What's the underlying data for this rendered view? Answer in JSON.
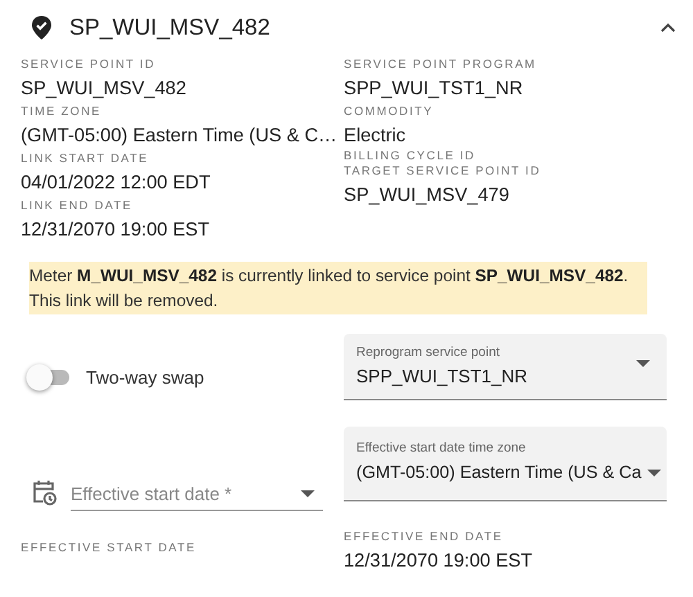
{
  "header": {
    "title": "SP_WUI_MSV_482",
    "expanded": true
  },
  "details": {
    "columns": [
      [
        {
          "label": "SERVICE POINT ID",
          "value": "SP_WUI_MSV_482"
        },
        {
          "label": "TIME ZONE",
          "value": "(GMT-05:00) Eastern Time (US & C…"
        },
        {
          "label": "LINK START DATE",
          "value": "04/01/2022 12:00 EDT"
        },
        {
          "label": "LINK END DATE",
          "value": "12/31/2070 19:00 EST"
        }
      ],
      [
        {
          "label": "SERVICE POINT PROGRAM",
          "value": "SPP_WUI_TST1_NR"
        },
        {
          "label": "COMMODITY",
          "value": "Electric"
        },
        {
          "label": "BILLING CYCLE ID"
        },
        {
          "label": "TARGET SERVICE POINT ID",
          "value": "SP_WUI_MSV_479"
        }
      ]
    ]
  },
  "banner": {
    "text": "Meter **M_WUI_MSV_482** is currently linked to service point **SP_WUI_MSV_482**. This link will be removed."
  },
  "form": {
    "rows": [
      [
        {
          "kind": "toggle",
          "label": "Two-way swap",
          "on": false
        },
        {
          "kind": "select",
          "label": "Reprogram service point",
          "value": "SPP_WUI_TST1_NR"
        }
      ],
      [
        {
          "kind": "date",
          "placeholder": "Effective start date *"
        },
        {
          "kind": "select",
          "label": "Effective start date time zone",
          "value": "(GMT-05:00) Eastern Time (US & Ca"
        }
      ],
      [
        {
          "kind": "readout",
          "label": "EFFECTIVE START DATE"
        },
        {
          "kind": "readout",
          "label": "EFFECTIVE END DATE",
          "value": "12/31/2070 19:00 EST"
        }
      ]
    ]
  }
}
